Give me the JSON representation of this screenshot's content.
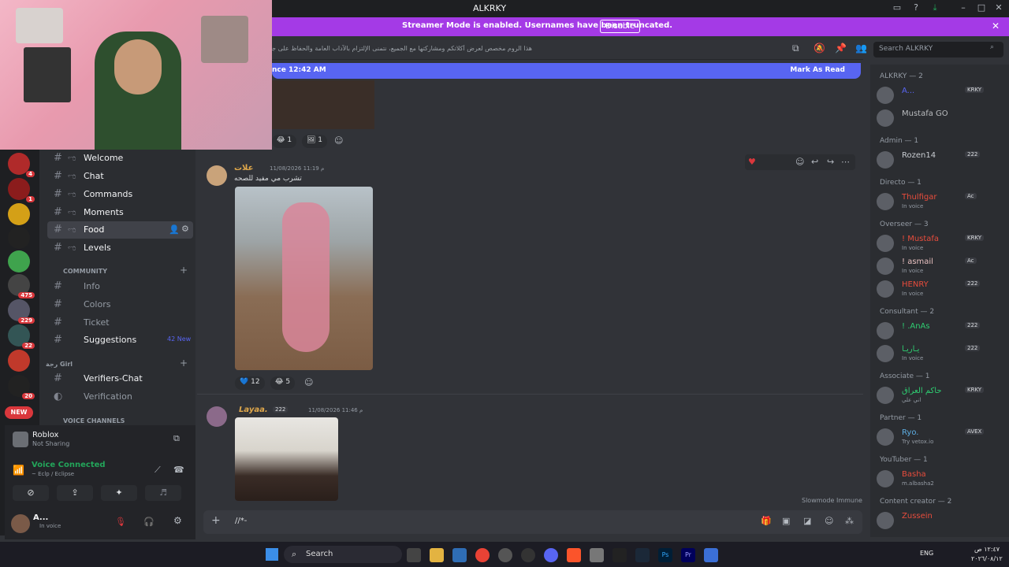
{
  "window": {
    "title": "ALKRKY"
  },
  "banner": {
    "message": "Streamer Mode is enabled. Usernames have been truncated.",
    "disable": "Disable"
  },
  "topic": {
    "text": "هذا الروم مخصص لعرض أكلاتكم ومشاركتها مع الجميع، نتمنى الإلتزام بالآداب العامة والحفاظ على جودة المحتوى"
  },
  "search": {
    "placeholder": "Search ALKRKY"
  },
  "newbar": {
    "since": "nce 12:42 AM",
    "mark": "Mark As Read"
  },
  "channels": {
    "items": [
      {
        "label": "Welcome",
        "emoji": "ಌ"
      },
      {
        "label": "Chat",
        "emoji": "ಌ"
      },
      {
        "label": "Commands",
        "emoji": "ಌ"
      },
      {
        "label": "Moments",
        "emoji": "ಌ"
      },
      {
        "label": "Food",
        "emoji": "ಌ"
      },
      {
        "label": "Levels",
        "emoji": "ಌ"
      }
    ],
    "community_label": "COMMUNITY",
    "community": [
      {
        "label": "Info"
      },
      {
        "label": "Colors"
      },
      {
        "label": "Ticket"
      },
      {
        "label": "Suggestions",
        "badge": "42 New"
      }
    ],
    "girl_label": "رجة Girl",
    "girl": [
      {
        "label": "Verifiers-Chat"
      },
      {
        "label": "Verification"
      }
    ],
    "voice_label": "VOICE CHANNELS"
  },
  "servers": {
    "badges": [
      "4",
      "1",
      "475",
      "229",
      "22",
      "20"
    ],
    "new": "NEW"
  },
  "activity": {
    "name": "Roblox",
    "status": "Not Sharing"
  },
  "voice": {
    "status": "Voice Connected",
    "channel": "~ Eclp / Eclipse"
  },
  "user": {
    "name": "A...",
    "status": "In voice"
  },
  "messages": [
    {
      "author": "علات",
      "time": "11/08/2026 11:19 م",
      "text": "تشرب مي مفيد للصحه",
      "reactions": [
        {
          "emoji": "💙",
          "count": "12"
        },
        {
          "emoji": "😂",
          "count": "5"
        }
      ]
    },
    {
      "author": "Layaa.",
      "tag": "222",
      "time": "11/08/2026 11:46 م"
    }
  ],
  "prev_reactions": [
    {
      "emoji": "😂",
      "count": "1"
    },
    {
      "emoji": "🖼",
      "count": "1"
    }
  ],
  "slowmode": "Slowmode Immune",
  "composer": {
    "placeholder": "//*-"
  },
  "members": {
    "groups": [
      {
        "role": "ALKRKY — 2",
        "members": [
          {
            "name": "A...",
            "tag": "KRKY",
            "color": "#5865f2"
          },
          {
            "name": "Mustafa GO",
            "color": "#b9bbbe"
          }
        ]
      },
      {
        "role": "Admin — 1",
        "members": [
          {
            "name": "Rozen14",
            "tag": "222",
            "color": "#c9cdd2"
          }
        ]
      },
      {
        "role": "Directo — 1",
        "members": [
          {
            "name": "Thulfigar",
            "tag": "Ac",
            "status": "In voice",
            "color": "#e74c3c"
          }
        ]
      },
      {
        "role": "Overseer — 3",
        "members": [
          {
            "name": "! Mustafa",
            "tag": "KRKY",
            "status": "In voice",
            "color": "#e74c3c"
          },
          {
            "name": "! asmail",
            "tag": "Ac",
            "status": "In voice",
            "color": "#e8c0c0"
          },
          {
            "name": "HENRY",
            "tag": "222",
            "status": "In voice",
            "color": "#e74c3c"
          }
        ]
      },
      {
        "role": "Consultant — 2",
        "members": [
          {
            "name": "! .AnAs",
            "tag": "222",
            "color": "#2ecc71"
          },
          {
            "name": "يـاريـا",
            "tag": "222",
            "status": "In voice",
            "color": "#2ecc71"
          }
        ]
      },
      {
        "role": "Associate — 1",
        "members": [
          {
            "name": "حاكم العراق",
            "tag": "KRKY",
            "status": "اني علي",
            "color": "#2ecc71"
          }
        ]
      },
      {
        "role": "Partner — 1",
        "members": [
          {
            "name": "Ryo.",
            "tag": "AVEX",
            "status": "Try vetox.io",
            "color": "#5dade2"
          }
        ]
      },
      {
        "role": "YouTuber — 1",
        "members": [
          {
            "name": "Basha",
            "status": "m.albasha2",
            "color": "#e74c3c"
          }
        ]
      },
      {
        "role": "Content creator — 2",
        "members": [
          {
            "name": "Zussein",
            "color": "#e74c3c"
          }
        ]
      }
    ]
  },
  "taskbar": {
    "search": "Search",
    "lang": "ENG",
    "time": "١٢:٤٧ ص",
    "date": "٢٠٢٦/٠٨/١٢"
  }
}
